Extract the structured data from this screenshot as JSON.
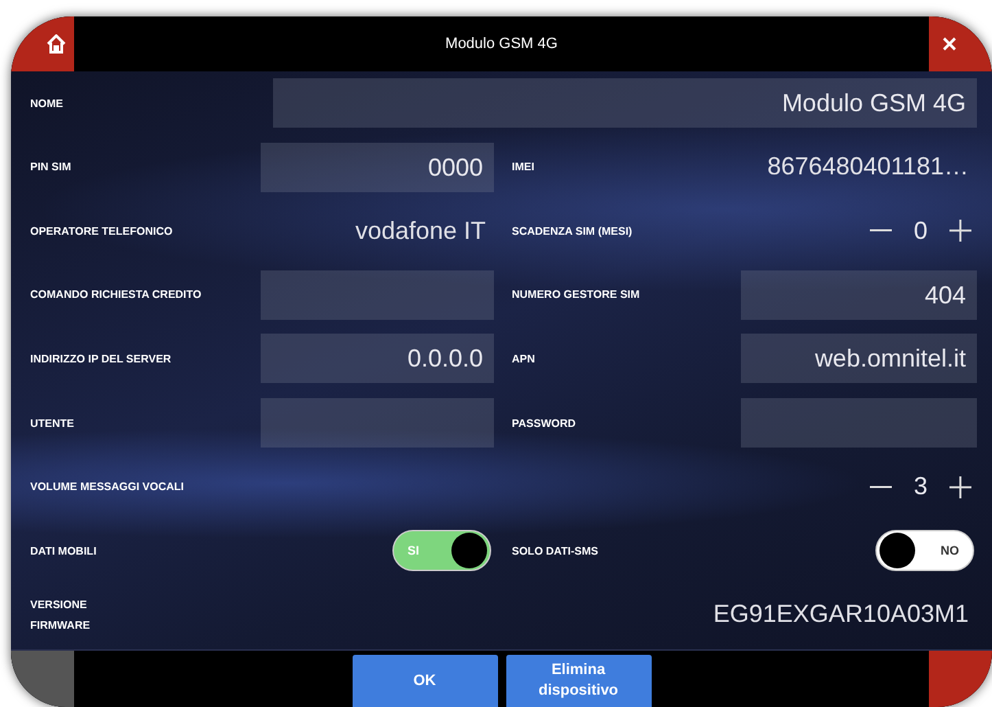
{
  "window": {
    "title": "Modulo GSM 4G"
  },
  "rows": [
    {
      "label": "NOME",
      "kind": "input",
      "value": "Modulo GSM 4G"
    },
    {
      "left": {
        "label": "PIN SIM",
        "kind": "input",
        "value": "0000"
      },
      "right": {
        "label": "IMEI",
        "kind": "text",
        "value": "8676480401181…"
      }
    },
    {
      "left": {
        "label": "OPERATORE TELEFONICO",
        "kind": "text",
        "value": "vodafone IT"
      },
      "right": {
        "label": "SCADENZA SIM (MESI)",
        "kind": "stepper",
        "value": "0"
      }
    },
    {
      "left": {
        "label": "COMANDO RICHIESTA CREDITO",
        "kind": "input"
      },
      "right": {
        "label": "NUMERO GESTORE SIM",
        "kind": "input",
        "value": "404"
      }
    },
    {
      "left": {
        "label": "INDIRIZZO IP DEL SERVER",
        "kind": "input",
        "value": "0.0.0.0"
      },
      "right": {
        "label": "APN",
        "kind": "input",
        "value": "web.omnitel.it"
      }
    },
    {
      "left": {
        "label": "UTENTE",
        "kind": "input"
      },
      "right": {
        "label": "PASSWORD",
        "kind": "input"
      }
    },
    {
      "label": "VOLUME MESSAGGI VOCALI",
      "kind": "stepper",
      "value": "3"
    },
    {
      "left": {
        "label": "DATI MOBILI",
        "kind": "toggle",
        "on": true,
        "value": "SI"
      },
      "right": {
        "label": "SOLO DATI-SMS",
        "kind": "toggle",
        "on": false,
        "value": "NO"
      }
    },
    {
      "label": "VERSIONE FIRMWARE",
      "kind": "text",
      "value": "EG91EXGAR10A03M1"
    }
  ],
  "buttons": [
    {
      "label": "OK"
    },
    {
      "label": "Elimina dispositivo"
    }
  ]
}
